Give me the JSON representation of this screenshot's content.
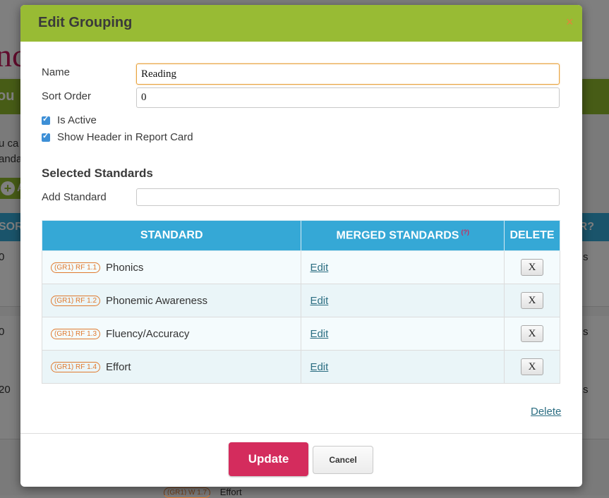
{
  "background": {
    "brand_fragment": "nc",
    "header_fragment": "ou",
    "info_lines": [
      "u ca",
      "anda"
    ],
    "add_fragment": "A",
    "col_left": "SOR",
    "col_right": "ER?",
    "row_numbers": [
      "0",
      "0",
      "20"
    ],
    "row_suffix": "s",
    "bottom_tag": "(GR1) W 1.7",
    "bottom_text": "Effort"
  },
  "modal": {
    "title": "Edit Grouping",
    "close": "×",
    "name_label": "Name",
    "name_value": "Reading",
    "sort_label": "Sort Order",
    "sort_value": "0",
    "is_active_label": "Is Active",
    "is_active_checked": true,
    "show_header_label": "Show Header in Report Card",
    "show_header_checked": true,
    "selected_title": "Selected Standards",
    "add_standard_label": "Add Standard",
    "add_standard_value": "",
    "table": {
      "headers": [
        "STANDARD",
        "MERGED STANDARDS",
        "DELETE"
      ],
      "help_mark": "(?)",
      "rows": [
        {
          "code": "(GR1) RF 1.1",
          "name": "Phonics",
          "merged": "Edit",
          "delete": "X"
        },
        {
          "code": "(GR1) RF 1.2",
          "name": "Phonemic Awareness",
          "merged": "Edit",
          "delete": "X"
        },
        {
          "code": "(GR1) RF 1.3",
          "name": "Fluency/Accuracy",
          "merged": "Edit",
          "delete": "X"
        },
        {
          "code": "(GR1) RF 1.4",
          "name": "Effort",
          "merged": "Edit",
          "delete": "X"
        }
      ]
    },
    "delete_link": "Delete",
    "update_button": "Update",
    "cancel_button": "Cancel"
  },
  "colors": {
    "header_green": "#98bb34",
    "table_blue": "#35a8d6",
    "update_pink": "#d42c5d",
    "tag_orange": "#e07a2e"
  }
}
